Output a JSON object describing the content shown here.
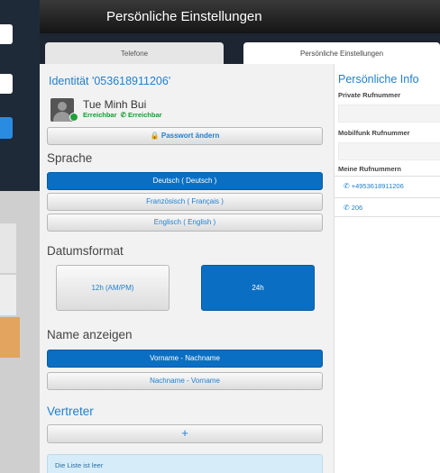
{
  "window": {
    "title": "Persönliche Einstellungen"
  },
  "tabs": [
    {
      "label": "Telefone"
    },
    {
      "label": "Persönliche Einstellungen"
    }
  ],
  "identity": {
    "title": "Identität '053618911206'",
    "user_name": "Tue Minh Bui",
    "presence_1": "Erreichbar",
    "presence_2": "Erreichbar",
    "password_button": "Passwort ändern"
  },
  "language": {
    "heading": "Sprache",
    "options": [
      {
        "label": "Deutsch ( Deutsch )",
        "selected": true
      },
      {
        "label": "Französisch ( Français )",
        "selected": false
      },
      {
        "label": "Englisch ( English )",
        "selected": false
      }
    ]
  },
  "date_format": {
    "heading": "Datumsformat",
    "options": [
      {
        "label": "12h (AM/PM)",
        "selected": false
      },
      {
        "label": "24h",
        "selected": true
      }
    ]
  },
  "display_name": {
    "heading": "Name anzeigen",
    "options": [
      {
        "label": "Vorname - Nachname",
        "selected": true
      },
      {
        "label": "Nachname - Vorname",
        "selected": false
      }
    ]
  },
  "deputy": {
    "heading": "Vertreter",
    "add_label": "+",
    "empty_text": "Die Liste ist leer"
  },
  "personal_info": {
    "title": "Persönliche Info",
    "private_label": "Private Rufnummer",
    "private_value": "",
    "mobile_label": "Mobilfunk Rufnummer",
    "mobile_value": "",
    "my_numbers_label": "Meine Rufnummern",
    "numbers": [
      "+4953618911206",
      "206"
    ]
  },
  "colors": {
    "accent": "#0a6fc2",
    "link": "#1f7fd0",
    "online": "#1fa23a"
  }
}
